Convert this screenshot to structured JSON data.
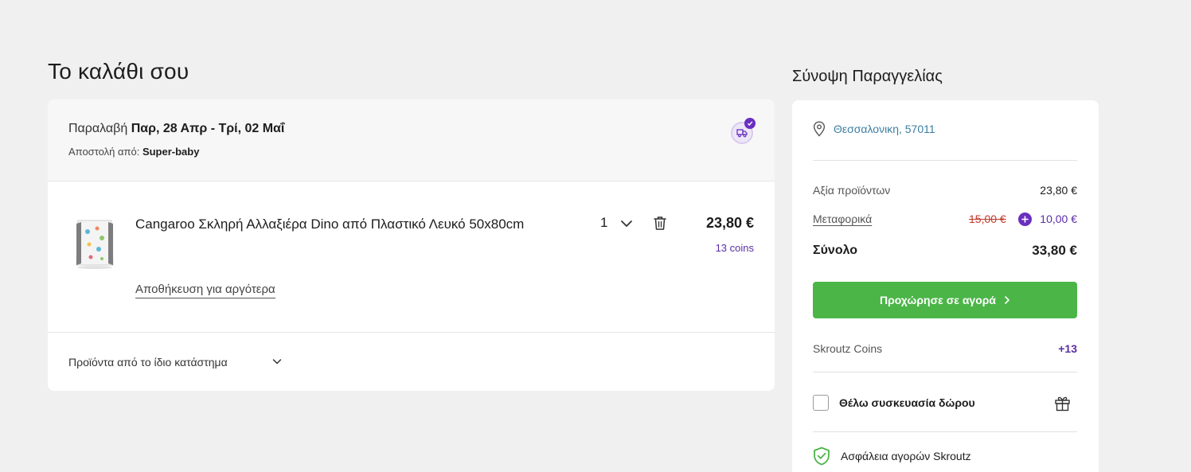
{
  "page": {
    "cart_title": "Το καλάθι σου",
    "summary_title": "Σύνοψη Παραγγελίας"
  },
  "cart": {
    "pickup_prefix": "Παραλαβή ",
    "pickup_dates": "Παρ, 28 Απρ - Τρί, 02 Μαΐ",
    "shipped_from_prefix": "Αποστολή από: ",
    "shipped_from_store": "Super-baby",
    "truck_icon": "delivery-truck-icon",
    "item": {
      "name": "Cangaroo Σκληρή Αλλαξιέρα Dino από Πλαστικό Λευκό 50x80cm",
      "quantity": "1",
      "price": "23,80 €",
      "coins": "13 coins",
      "save_for_later": "Αποθήκευση για αργότερα"
    },
    "same_store_label": "Προϊόντα από το ίδιο κατάστημα"
  },
  "summary": {
    "location": "Θεσσαλονικη, 57011",
    "products_label": "Αξία προϊόντων",
    "products_value": "23,80 €",
    "shipping_label": "Μεταφορικά",
    "shipping_old": "15,00 €",
    "shipping_new": "10,00 €",
    "total_label": "Σύνολο",
    "total_value": "33,80 €",
    "checkout_label": "Προχώρησε σε αγορά",
    "coins_label": "Skroutz Coins",
    "coins_value": "+13",
    "gift_label": "Θέλω συσκευασία δώρου",
    "safety_label": "Ασφάλεια αγορών Skroutz"
  },
  "colors": {
    "accent_green": "#4bb548",
    "accent_purple": "#6a2fc0",
    "link_blue": "#3b7ea1",
    "strike_red": "#c0392b"
  }
}
